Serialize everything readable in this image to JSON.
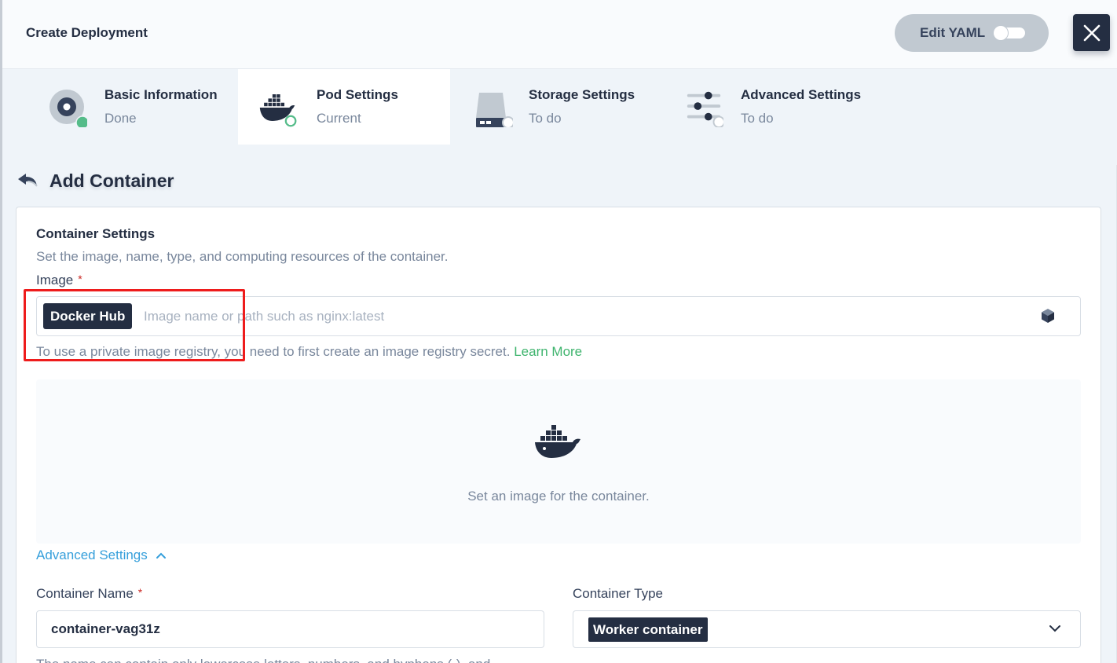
{
  "header": {
    "title": "Create Deployment",
    "edit_yaml_label": "Edit YAML"
  },
  "steps": [
    {
      "title": "Basic Information",
      "status": "Done",
      "icon": "info-circle-icon"
    },
    {
      "title": "Pod Settings",
      "status": "Current",
      "icon": "docker-whale-icon"
    },
    {
      "title": "Storage Settings",
      "status": "To do",
      "icon": "storage-disk-icon"
    },
    {
      "title": "Advanced Settings",
      "status": "To do",
      "icon": "sliders-icon"
    }
  ],
  "page": {
    "title": "Add Container"
  },
  "container_settings": {
    "title": "Container Settings",
    "description": "Set the image, name, type, and computing resources of the container.",
    "image_label": "Image",
    "required_mark": "*",
    "registry_tag": "Docker Hub",
    "image_placeholder": "Image name or path such as nginx:latest",
    "image_value": "",
    "hint_text": "To use a private image registry, you need to first create an image registry secret.",
    "learn_more": "Learn More",
    "empty_text": "Set an image for the container.",
    "advanced_toggle": "Advanced Settings",
    "name_label": "Container Name",
    "name_value": "container-vag31z",
    "type_label": "Container Type",
    "type_value": "Worker container",
    "name_hint": "The name can contain only lowercase letters, numbers, and hyphens (-), and"
  },
  "colors": {
    "primary_dark": "#242e42",
    "success": "#55bc8a",
    "link_green": "#3fb46e",
    "link_blue": "#369fdb",
    "annotation_red": "#ee1c1c"
  }
}
